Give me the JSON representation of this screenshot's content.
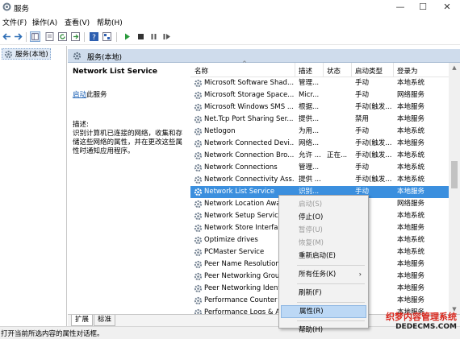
{
  "window": {
    "title": "服务"
  },
  "menu": [
    "文件(F)",
    "操作(A)",
    "查看(V)",
    "帮助(H)"
  ],
  "toolbar": {
    "icons": [
      "back-icon",
      "forward-icon",
      "console-tree-icon",
      "properties-icon",
      "refresh-icon",
      "export-icon",
      "help-icon",
      "view-icon",
      "start-icon",
      "stop-icon",
      "pause-icon",
      "restart-icon"
    ]
  },
  "tree": {
    "node_label": "服务(本地)"
  },
  "main": {
    "header_title": "服务(本地)"
  },
  "description": {
    "service_name": "Network List Service",
    "start_link": "启动",
    "start_suffix": "此服务",
    "desc_label": "描述:",
    "desc_text": "识别计算机已连接的网络，收集和存储这些网络的属性，并在更改这些属性时通知应用程序。"
  },
  "columns": [
    "名称",
    "描述",
    "状态",
    "启动类型",
    "登录为"
  ],
  "rows": [
    {
      "name": "Microsoft Software Shad...",
      "desc": "管理...",
      "status": "",
      "startup": "手动",
      "logon": "本地系统"
    },
    {
      "name": "Microsoft Storage Space...",
      "desc": "Micr...",
      "status": "",
      "startup": "手动",
      "logon": "网络服务"
    },
    {
      "name": "Microsoft Windows SMS ...",
      "desc": "根据...",
      "status": "",
      "startup": "手动(触发...",
      "logon": "本地服务"
    },
    {
      "name": "Net.Tcp Port Sharing Ser...",
      "desc": "提供...",
      "status": "",
      "startup": "禁用",
      "logon": "本地服务"
    },
    {
      "name": "Netlogon",
      "desc": "为用...",
      "status": "",
      "startup": "手动",
      "logon": "本地系统"
    },
    {
      "name": "Network Connected Devi...",
      "desc": "网络...",
      "status": "",
      "startup": "手动(触发...",
      "logon": "本地服务"
    },
    {
      "name": "Network Connection Bro...",
      "desc": "允许 ...",
      "status": "正在...",
      "startup": "手动(触发...",
      "logon": "本地系统"
    },
    {
      "name": "Network Connections",
      "desc": "管理...",
      "status": "",
      "startup": "手动",
      "logon": "本地系统"
    },
    {
      "name": "Network Connectivity Ass...",
      "desc": "提供 ...",
      "status": "",
      "startup": "手动(触发...",
      "logon": "本地系统"
    },
    {
      "name": "Network List Service",
      "desc": "识别...",
      "status": "",
      "startup": "手动",
      "logon": "本地服务"
    },
    {
      "name": "Network Location Awar...",
      "desc": "",
      "status": "",
      "startup": "",
      "logon": "网络服务"
    },
    {
      "name": "Network Setup Service",
      "desc": "",
      "status": "",
      "startup": "",
      "logon": "本地系统"
    },
    {
      "name": "Network Store Interfac...",
      "desc": "",
      "status": "",
      "startup": "",
      "logon": "本地服务"
    },
    {
      "name": "Optimize drives",
      "desc": "",
      "status": "",
      "startup": "",
      "logon": "本地系统"
    },
    {
      "name": "PCMaster Service",
      "desc": "",
      "status": "",
      "startup": "",
      "logon": "本地系统"
    },
    {
      "name": "Peer Name Resolution ...",
      "desc": "",
      "status": "",
      "startup": "",
      "logon": "本地服务"
    },
    {
      "name": "Peer Networking Grou...",
      "desc": "",
      "status": "",
      "startup": "",
      "logon": "本地服务"
    },
    {
      "name": "Peer Networking Ident...",
      "desc": "",
      "status": "",
      "startup": "",
      "logon": "本地服务"
    },
    {
      "name": "Performance Counter L...",
      "desc": "",
      "status": "",
      "startup": "",
      "logon": "本地服务"
    },
    {
      "name": "Performance Logs & Al...",
      "desc": "",
      "status": "",
      "startup": "",
      "logon": "本地服务"
    }
  ],
  "selected_row": 9,
  "context_menu": {
    "items": [
      {
        "label": "启动(S)",
        "disabled": true
      },
      {
        "label": "停止(O)",
        "disabled": false
      },
      {
        "label": "暂停(U)",
        "disabled": true
      },
      {
        "label": "恢复(M)",
        "disabled": true
      },
      {
        "label": "重新启动(E)",
        "disabled": false
      },
      {
        "label": "所有任务(K)",
        "disabled": false,
        "submenu": true
      },
      {
        "label": "刷新(F)",
        "disabled": false
      },
      {
        "label": "属性(R)",
        "disabled": false,
        "highlighted": true
      },
      {
        "label": "帮助(H)",
        "disabled": false
      }
    ]
  },
  "tabs": [
    "扩展",
    "标准"
  ],
  "status_text": "打开当前所选内容的属性对话框。",
  "watermark": {
    "line1": "织梦内容管理系统",
    "line2": "DEDECMS.COM"
  },
  "colors": {
    "selection": "#3b8fde",
    "header_band": "#cfdcec",
    "menu_highlight": "#bcd8f5",
    "link": "#1a5fb4",
    "watermark_red": "#d8261c"
  }
}
